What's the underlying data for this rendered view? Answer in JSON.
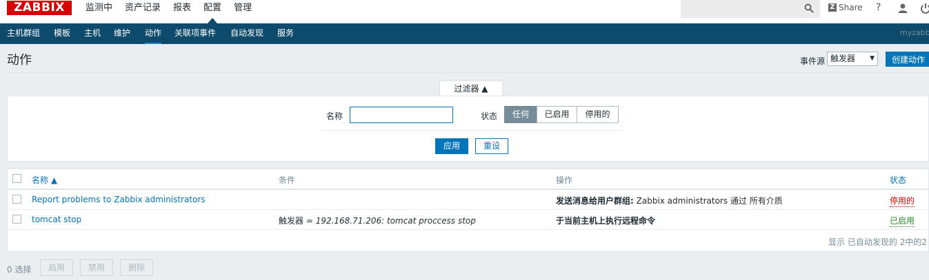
{
  "brand": {
    "logo": "ZABBIX",
    "server_name": "myzabbix"
  },
  "main_menu": [
    "监测中",
    "资产记录",
    "报表",
    "配置",
    "管理"
  ],
  "main_menu_active": "配置",
  "topbar": {
    "share_label": "Share",
    "help_label": "?"
  },
  "sub_menu": [
    "主机群组",
    "模板",
    "主机",
    "维护",
    "动作",
    "关联项事件",
    "自动发现",
    "服务"
  ],
  "sub_menu_active": "动作",
  "page": {
    "title": "动作",
    "event_source_label": "事件源",
    "event_source_value": "触发器",
    "create_button": "创建动作"
  },
  "filter": {
    "tab_label": "过滤器 ▲",
    "name_label": "名称",
    "name_value": "",
    "status_label": "状态",
    "status_options": [
      "任何",
      "已启用",
      "停用的"
    ],
    "status_selected": "任何",
    "apply_button": "应用",
    "reset_button": "重设"
  },
  "table": {
    "columns": [
      "名称 ▲",
      "条件",
      "操作",
      "状态"
    ],
    "rows": [
      {
        "name": "Report problems to Zabbix administrators",
        "condition_key": "",
        "condition_value": "",
        "operation_bold": "发送消息给用户群组:",
        "operation_rest": " Zabbix administrators 通过 所有介质",
        "status": "停用的",
        "status_color": "#dd0000"
      },
      {
        "name": "tomcat stop",
        "condition_key": "触发器 = ",
        "condition_value": "192.168.71.206: tomcat proccess stop",
        "operation_bold": "于当前主机上执行远程命令",
        "operation_rest": "",
        "status": "已启用",
        "status_color": "#2a8a2a"
      }
    ],
    "footer": "显示 已自动发现的 2中的2"
  },
  "bulk": {
    "selected_count": "0 选择",
    "enable_button": "启用",
    "disable_button": "禁用",
    "delete_button": "删除"
  },
  "colors": {
    "accent": "#0275b8",
    "nav_bg": "#0e4a6b",
    "logo_red": "#d40000"
  }
}
